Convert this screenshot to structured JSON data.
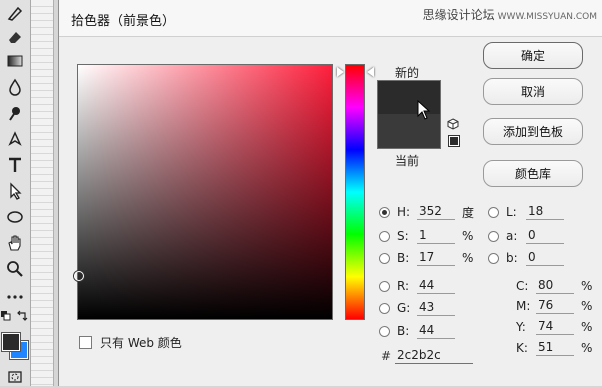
{
  "dialog": {
    "title": "拾色器（前景色）",
    "watermark": "思缘设计论坛",
    "watermark_url": "WWW.MISSYUAN.COM"
  },
  "swatches": {
    "new_label": "新的",
    "current_label": "当前",
    "new_color": "#2c2b2c",
    "current_color": "#3a3a3a"
  },
  "buttons": {
    "ok": "确定",
    "cancel": "取消",
    "add_to_swatches": "添加到色板",
    "color_libraries": "颜色库"
  },
  "hsb": {
    "h_label": "H:",
    "h_value": "352",
    "h_unit": "度",
    "s_label": "S:",
    "s_value": "1",
    "s_unit": "%",
    "b_label": "B:",
    "b_value": "17",
    "b_unit": "%"
  },
  "rgb": {
    "r_label": "R:",
    "r_value": "44",
    "g_label": "G:",
    "g_value": "43",
    "b_label": "B:",
    "b_value": "44"
  },
  "lab": {
    "l_label": "L:",
    "l_value": "18",
    "a_label": "a:",
    "a_value": "0",
    "b_label": "b:",
    "b_value": "0"
  },
  "cmyk": {
    "c_label": "C:",
    "c_value": "80",
    "c_unit": "%",
    "m_label": "M:",
    "m_value": "76",
    "m_unit": "%",
    "y_label": "Y:",
    "y_value": "74",
    "y_unit": "%",
    "k_label": "K:",
    "k_value": "51",
    "k_unit": "%"
  },
  "hex": {
    "hash": "#",
    "value": "2c2b2c"
  },
  "web_only_label": "只有 Web 颜色",
  "colors": {
    "foreground": "#2c2b2c",
    "background": "#1f86ff",
    "hue_base": "#ff1f3c"
  }
}
